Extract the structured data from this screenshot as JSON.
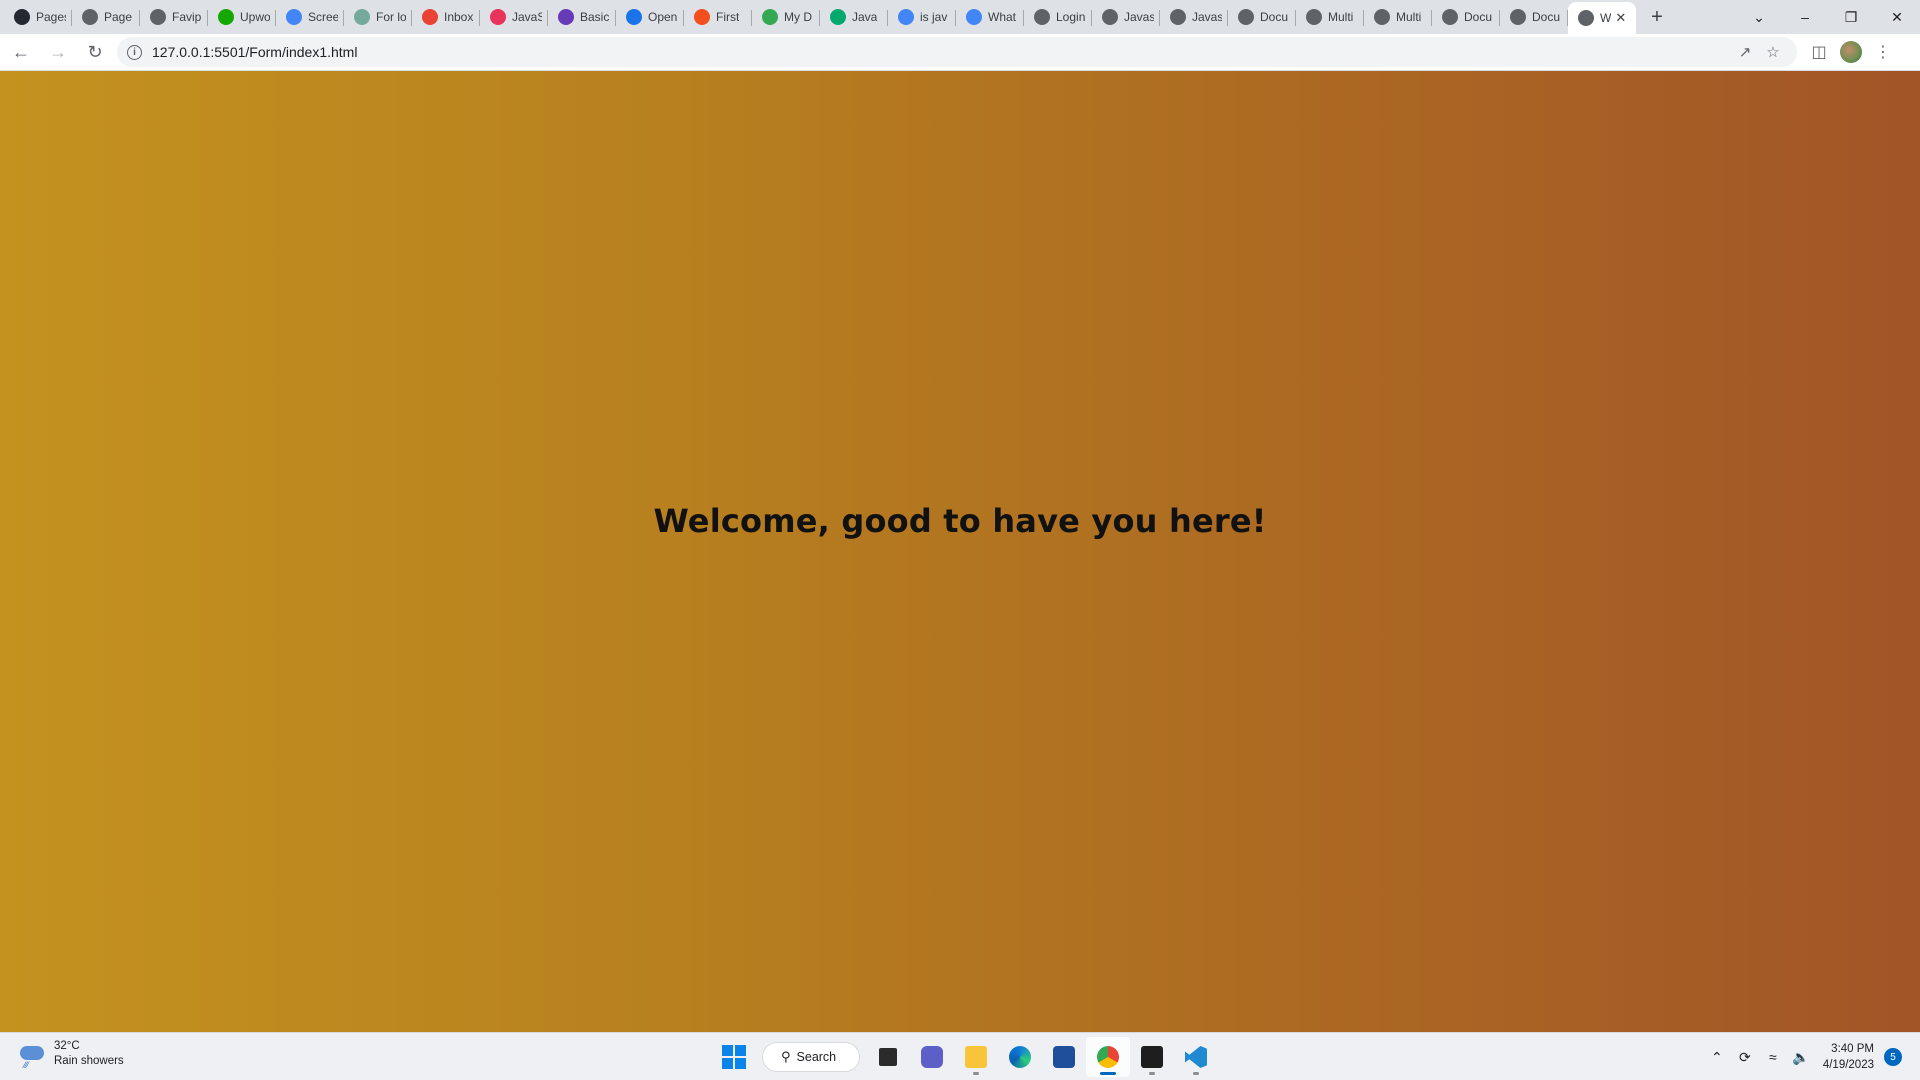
{
  "browser": {
    "tabs": [
      {
        "title": "Pages",
        "icon": "github-icon",
        "color": "#24292f"
      },
      {
        "title": "Page",
        "icon": "globe-icon",
        "color": "#5f6368"
      },
      {
        "title": "Favip",
        "icon": "globe-icon",
        "color": "#5f6368"
      },
      {
        "title": "Upwo",
        "icon": "upwork-icon",
        "color": "#14a800"
      },
      {
        "title": "Scree",
        "icon": "docs-icon",
        "color": "#4285f4"
      },
      {
        "title": "For lo",
        "icon": "chatgpt-icon",
        "color": "#74aa9c"
      },
      {
        "title": "Inbox",
        "icon": "gmail-icon",
        "color": "#ea4335"
      },
      {
        "title": "JavaS",
        "icon": "javascript-info-icon",
        "color": "#e8335b"
      },
      {
        "title": "Basic",
        "icon": "forms-icon",
        "color": "#673ab7"
      },
      {
        "title": "Open",
        "icon": "open-icon",
        "color": "#1a73e8"
      },
      {
        "title": "First",
        "icon": "figma-icon",
        "color": "#f24e1e"
      },
      {
        "title": "My D",
        "icon": "drive-icon",
        "color": "#34a853"
      },
      {
        "title": "Java",
        "icon": "w3schools-icon",
        "color": "#04aa6d"
      },
      {
        "title": "is jav",
        "icon": "google-icon",
        "color": "#4285f4"
      },
      {
        "title": "What",
        "icon": "google-icon",
        "color": "#4285f4"
      },
      {
        "title": "Login",
        "icon": "globe-icon",
        "color": "#5f6368"
      },
      {
        "title": "Javas",
        "icon": "globe-icon",
        "color": "#5f6368"
      },
      {
        "title": "Javas",
        "icon": "globe-icon",
        "color": "#5f6368"
      },
      {
        "title": "Docu",
        "icon": "globe-icon",
        "color": "#5f6368"
      },
      {
        "title": "Multi",
        "icon": "globe-icon",
        "color": "#5f6368"
      },
      {
        "title": "Multi",
        "icon": "globe-icon",
        "color": "#5f6368"
      },
      {
        "title": "Docu",
        "icon": "globe-icon",
        "color": "#5f6368"
      },
      {
        "title": "Docu",
        "icon": "globe-icon",
        "color": "#5f6368"
      }
    ],
    "active_tab": {
      "title": "W",
      "icon": "globe-icon",
      "color": "#5f6368"
    },
    "url": "127.0.0.1:5501/Form/index1.html"
  },
  "page": {
    "heading": "Welcome, good to have you here!",
    "gradient_start": "#c3921f",
    "gradient_end": "#a25527"
  },
  "taskbar": {
    "weather": {
      "temp": "32°C",
      "desc": "Rain showers"
    },
    "search_label": "Search",
    "apps": [
      "start-icon",
      "search-icon",
      "task-view-icon",
      "teams-chat-icon",
      "file-explorer-icon",
      "edge-icon",
      "store-icon",
      "chrome-icon",
      "terminal-icon",
      "vscode-icon"
    ],
    "clock": {
      "time": "3:40 PM",
      "date": "4/19/2023"
    },
    "notifications": "5"
  }
}
